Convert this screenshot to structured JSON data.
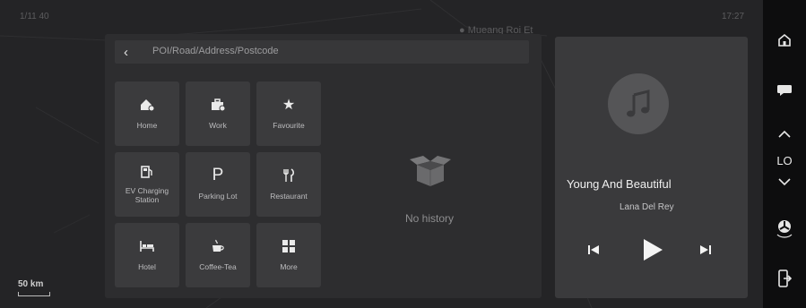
{
  "status_bar": {
    "left_text": "1/11 40",
    "center_text": "",
    "right_text": "17:27"
  },
  "map": {
    "place_label": "Mueang Roi Et",
    "scale_label": "50 km"
  },
  "search": {
    "back_icon": "chevron-left",
    "placeholder": "POI/Road/Address/Postcode"
  },
  "shortcuts": [
    {
      "label": "Home",
      "icon": "home-icon"
    },
    {
      "label": "Work",
      "icon": "briefcase-icon"
    },
    {
      "label": "Favourite",
      "icon": "star-icon"
    },
    {
      "label": "EV Charging Station",
      "icon": "ev-charger-icon"
    },
    {
      "label": "Parking Lot",
      "icon": "parking-icon",
      "glyph": "P"
    },
    {
      "label": "Restaurant",
      "icon": "fork-knife-icon"
    },
    {
      "label": "Hotel",
      "icon": "bed-icon"
    },
    {
      "label": "Coffee-Tea",
      "icon": "coffee-icon"
    },
    {
      "label": "More",
      "icon": "grid-icon"
    }
  ],
  "history": {
    "empty_text": "No history"
  },
  "music": {
    "song_title": "Young And Beautiful",
    "artist": "Lana Del Rey",
    "controls": [
      "previous-icon",
      "play-icon",
      "next-icon"
    ]
  },
  "side_rail": {
    "items": [
      "home-icon",
      "message-icon",
      "chevron-up-icon",
      "chevron-down-icon",
      "fan-icon",
      "phone-exit-icon"
    ],
    "climate_level": "LO"
  },
  "colors": {
    "background": "#1f1f21",
    "panel": "#2d2d2f",
    "tile": "#3b3b3d",
    "music_card": "#3a3a3c",
    "rail": "#0d0d0e"
  }
}
